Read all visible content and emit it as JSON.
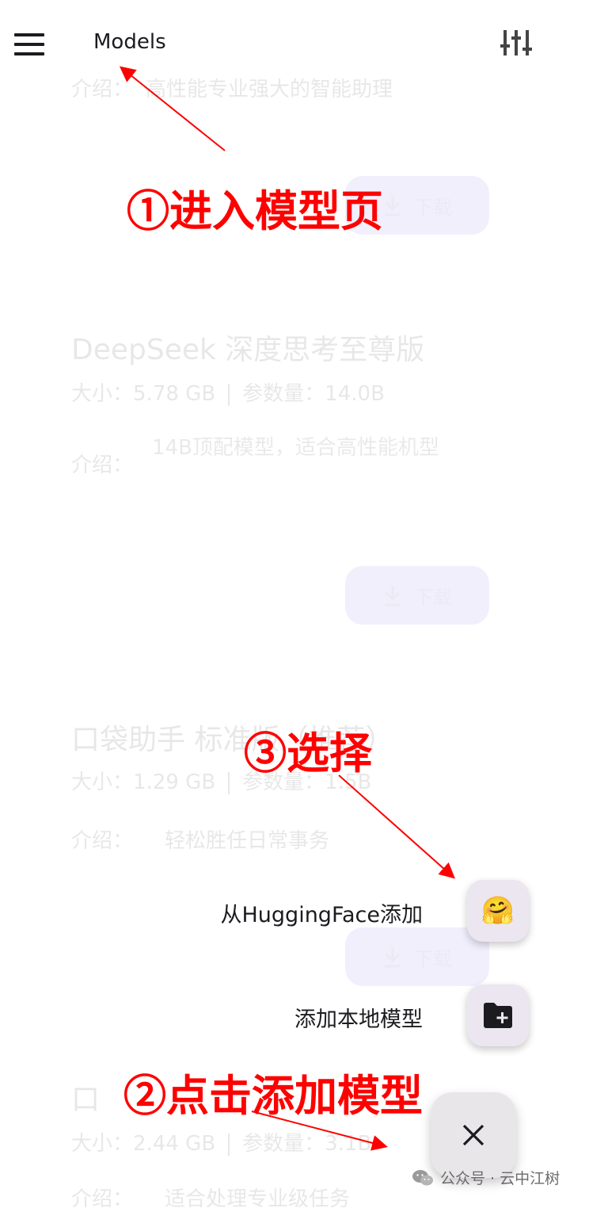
{
  "appbar": {
    "title": "Models"
  },
  "icons": {
    "menu": "menu-icon",
    "tune": "tune-icon",
    "huggingface": "hugging-face-emoji-icon",
    "add_folder": "create-new-folder-icon",
    "close": "close-icon",
    "download": "download-icon",
    "wechat": "wechat-icon"
  },
  "background_models": [
    {
      "desc_label": "介绍：",
      "desc_partial": "高性能专业强大的智能助理",
      "download_label": "下载"
    },
    {
      "name": "DeepSeek 深度思考至尊版",
      "size_label": "大小：",
      "size": "5.78 GB",
      "params_label": "参数量：",
      "params": "14.0B",
      "desc_label": "介绍：",
      "desc": "14B顶配模型，适合高性能机型",
      "download_label": "下载"
    },
    {
      "name": "口袋助手 标准版（推荐）",
      "size_label": "大小：",
      "size": "1.29 GB",
      "params_label": "参数量：",
      "params": "1.5B",
      "desc_label": "介绍：",
      "desc": "轻松胜任日常事务",
      "download_label": "下载"
    },
    {
      "name": "口",
      "size_label": "大小：",
      "size": "2.44 GB",
      "params_label": "参数量：",
      "params": "3.1B",
      "desc_label": "介绍：",
      "desc": "适合处理专业级任务"
    }
  ],
  "speed_dial": {
    "hf_label": "从HuggingFace添加",
    "hf_emoji": "🤗",
    "local_label": "添加本地模型",
    "close_glyph": "✕"
  },
  "annotations": {
    "step1": "①进入模型页",
    "step2": "②点击添加模型",
    "step3": "③选择",
    "color": "#ff0000"
  },
  "watermark": {
    "text": "公众号 · 云中江树"
  }
}
